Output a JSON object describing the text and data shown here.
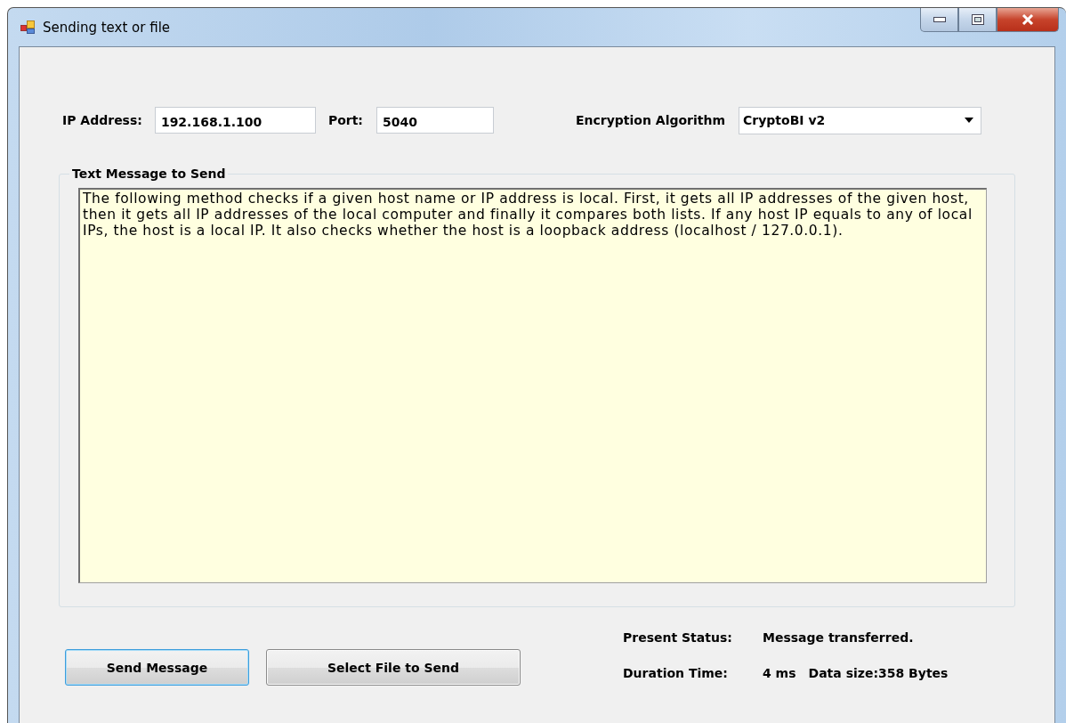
{
  "window": {
    "title": "Sending text or file"
  },
  "connection": {
    "ip_label": "IP Address:",
    "ip_value": "192.168.1.100",
    "port_label": "Port:",
    "port_value": "5040",
    "algorithm_label": "Encryption Algorithm",
    "algorithm_value": "CryptoBI v2"
  },
  "message_group": {
    "title": "Text Message to Send",
    "text": "The following method checks if a given host name or IP address is local. First, it gets all IP addresses of the given host, then it gets all IP addresses of the local computer and finally it compares both lists. If any host IP equals to any of local IPs, the host is a local IP. It also checks whether the host is a loopback address (localhost / 127.0.0.1)."
  },
  "buttons": [
    {
      "label": "Send Message",
      "focused": true
    },
    {
      "label": "Select File to Send",
      "focused": false
    }
  ],
  "status": {
    "status_label": "Present Status:",
    "status_value": "Message transferred.",
    "duration_label": "Duration Time:",
    "duration_value": "4 ms",
    "size_value": "Data size:358 Bytes"
  }
}
